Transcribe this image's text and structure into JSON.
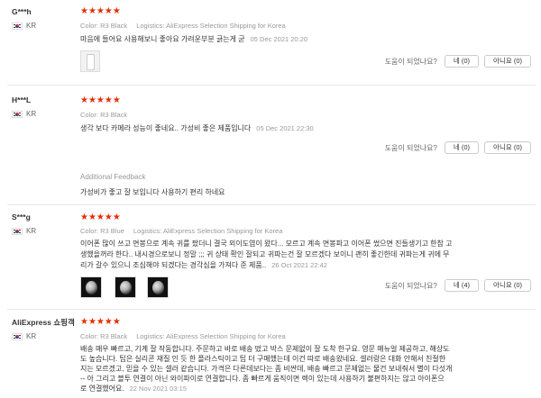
{
  "labels": {
    "color_key": "Color:",
    "logistics_key": "Logistics:",
    "helpful_question": "도움이 되었나요?",
    "additional_feedback": "Additional Feedback"
  },
  "rating_stars": "★★★★★",
  "colors": {
    "star": "#e62e04",
    "meta": "#999999",
    "text": "#333333"
  },
  "reviews": [
    {
      "user": "G***h",
      "country": "KR",
      "color": "R3 Black",
      "logistics": "AliExpress Selection Shipping for Korea",
      "text": "마음에 들어요 사용해보니 좋아요 가려운부분 긁는게 굳",
      "date": "05 Dec 2021 20:20",
      "yes": "네 (0)",
      "no": "아니요 (0)"
    },
    {
      "user": "H***L",
      "country": "KR",
      "color": "R3 Black",
      "logistics": "AliExpress Selection Shipping for Korea",
      "text": "생각 보다 카메라 성능이 좋네요.. 가성비 좋은 제품입니다",
      "date": "05 Dec 2021 22:30",
      "yes": "네 (0)",
      "no": "아니요 (0)",
      "additional_text": "가성비가 좋고 잘 보입니다 사용하기 편리 하네요"
    },
    {
      "user": "S***g",
      "country": "KR",
      "color": "R3 Blue",
      "logistics": "AliExpress Selection Shipping for Korea",
      "text_lines": [
        "이어폰 많이 쓰고 면봉으로 계속 귀를 팠더니 결국 외이도염이 왔다... 모르고 계속 면봉파고 이어폰 썼으면 진들생기고 한참 고",
        "생했을꺼라 한다.. 내시경으로보니 정말 ;;; 귀 상태 확인 잘되고 귀파는건 잘 모르겠다 보이니 괜히 좋긴한데 귀파는게 귀에 무",
        "리가 갈수 있으니 조심해야 되겠다는 경각심을 가져다 준 제품.."
      ],
      "date": "26 Oct 2021 22:42",
      "yes": "네 (4)",
      "no": "아니요 (0)"
    },
    {
      "user": "AliExpress 쇼핑객",
      "country": "KR",
      "color": "R3 Black",
      "logistics": "AliExpress Selection Shipping for Korea",
      "text_lines": [
        "배송 매우 빠르고, 기계 잘 작동합니다. 주문하고 바로 배송 떴고 박스 문제없이 잘 도착 한구요. 영문 매뉴얼 제공하고, 해상도",
        "도 높습니다. 팁은 실리콘 재질 인 듯 한 플라스틱이고 팁 더 구매했는데 이건 따로 배송왔네요. 셀러랑은 대화 안해서 친절한",
        "지는 모르겠고, 믿을 수 있는 셀러 같습니다. 가격은 다른데보다는 좀 비싼데, 배송 빠르고 문제없는 물건 보내줘서 별이 다섯개",
        "-- 아 그리고 블투 연결이 아닌 와이파이로 연결합니다. 좀 빠르게 움직이면 렉이 있는데 사용하기 불편하지는 않고 아이폰으",
        "로 연결했어요."
      ],
      "date": "22 Nov 2021 03:15"
    }
  ]
}
